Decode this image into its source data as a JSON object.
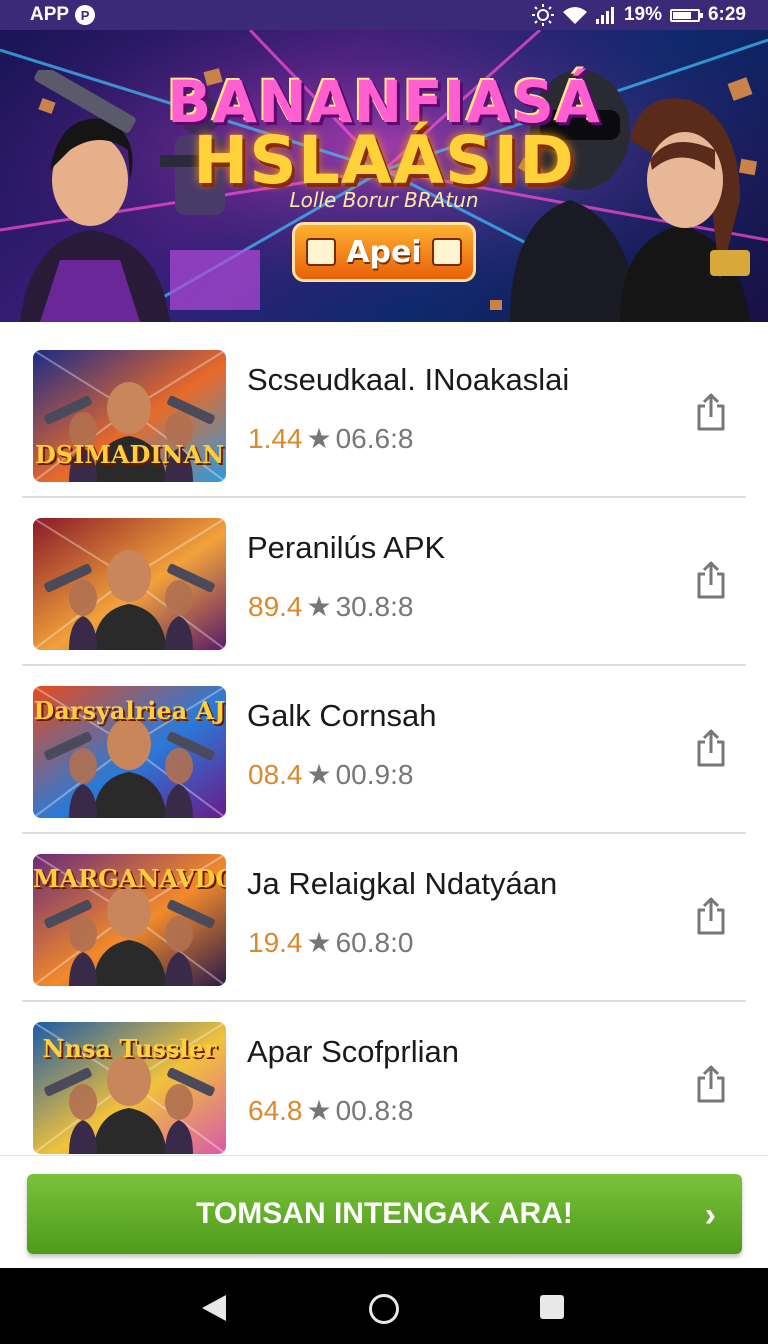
{
  "status_bar": {
    "app_label": "APP",
    "badge": "P",
    "battery_text": "19%",
    "battery_level": 0.7,
    "time": "6:29"
  },
  "banner": {
    "title_line1": "BANANFIASÁ",
    "title_line2": "HSLAÁSID",
    "subtitle": "Lolle Borur BRAtun",
    "button_label": "Apei"
  },
  "apps": [
    {
      "name": "Scseudkaal. INoakaslai",
      "rating": "1.44",
      "count": "06.6:8",
      "thumb_label": "DSIMADINAN",
      "thumb_colors": [
        "#1a2a8a",
        "#e86a2a",
        "#2a9adf"
      ]
    },
    {
      "name": "Peranilús APK",
      "rating": "89.4",
      "count": "30.8:8",
      "thumb_label": "",
      "thumb_colors": [
        "#8a1a2a",
        "#f2a23a",
        "#5a1a6a"
      ]
    },
    {
      "name": "Galk Cornsah",
      "rating": "08.4",
      "count": "00.9:8",
      "thumb_label": "Darsyalriea AJ",
      "thumb_colors": [
        "#e84a1a",
        "#2a7ad8",
        "#6a1a8a"
      ]
    },
    {
      "name": "Ja  Relaigkal Ndatyáan",
      "rating": "19.4",
      "count": "60.8:0",
      "thumb_label": "MARGANAVDON",
      "thumb_colors": [
        "#6a2a7a",
        "#f28a2a",
        "#2a1a4a"
      ]
    },
    {
      "name": "Apar Scofprlian",
      "rating": "64.8",
      "count": "00.8:8",
      "thumb_label": "Nnsa Tussler",
      "thumb_colors": [
        "#1a5aa8",
        "#f2c23a",
        "#d85aa8"
      ]
    }
  ],
  "cta": {
    "label": "TOMSAN INTENGAK ARA!"
  },
  "icons": {
    "share": "share-icon",
    "star": "★",
    "cta_arrow": "›"
  },
  "colors": {
    "status_bar": "#3a2a78",
    "rating": "#d98a2c",
    "cta": "#5ea824"
  }
}
